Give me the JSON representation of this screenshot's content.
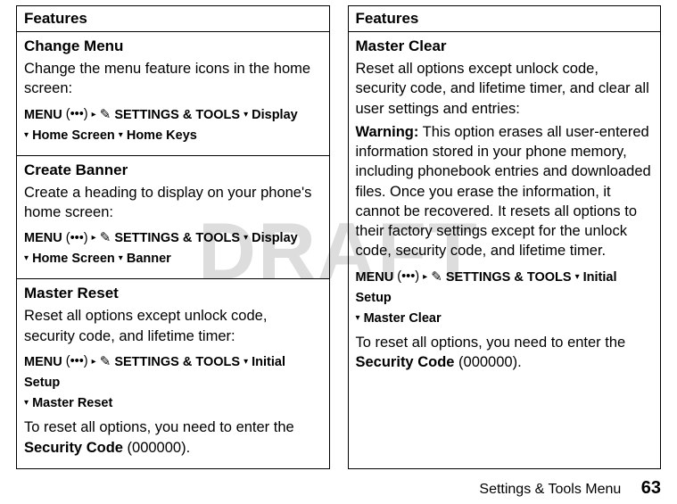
{
  "watermark": "DRAFT",
  "left": {
    "header": "Features",
    "sections": [
      {
        "title": "Change Menu",
        "body1": "Change the menu feature icons in the home screen:",
        "path_menu": "MENU",
        "path_bump": "(•••)",
        "path_arrow": "▸",
        "path_tools_icon": "✎",
        "path_tools": "SETTINGS & TOOLS",
        "path_sep": "▾",
        "path_item1": "Display",
        "path_item2": "Home Screen",
        "path_item3": "Home Keys"
      },
      {
        "title": "Create Banner",
        "body1": "Create a heading to display on your phone's home screen:",
        "path_menu": "MENU",
        "path_bump": "(•••)",
        "path_arrow": "▸",
        "path_tools_icon": "✎",
        "path_tools": "SETTINGS & TOOLS",
        "path_sep": "▾",
        "path_item1": "Display",
        "path_item2": "Home Screen",
        "path_item3": "Banner"
      },
      {
        "title": "Master Reset",
        "body1": "Reset all options except unlock code, security code, and lifetime timer:",
        "path_menu": "MENU",
        "path_bump": "(•••)",
        "path_arrow": "▸",
        "path_tools_icon": "✎",
        "path_tools": "SETTINGS & TOOLS",
        "path_sep": "▾",
        "path_item1": "Initial Setup",
        "path_item2": "Master Reset",
        "body2a": "To reset all options, you need to enter the ",
        "body2b": "Security Code",
        "body2c": " (000000)."
      }
    ]
  },
  "right": {
    "header": "Features",
    "section": {
      "title": "Master Clear",
      "body1": "Reset all options except unlock code, security code, and lifetime timer, and clear all user settings and entries:",
      "warning_label": "Warning:",
      "warning_body": " This option erases all user-entered information stored in your phone memory, including phonebook entries and downloaded files. Once you erase the information, it cannot be recovered. It resets all options to their factory settings except for the unlock code, security code, and lifetime timer.",
      "path_menu": "MENU",
      "path_bump": "(•••)",
      "path_arrow": "▸",
      "path_tools_icon": "✎",
      "path_tools": "SETTINGS & TOOLS",
      "path_sep": "▾",
      "path_item1": "Initial Setup",
      "path_item2": "Master Clear",
      "body2a": "To reset all options, you need to enter the ",
      "body2b": "Security Code",
      "body2c": " (000000)."
    }
  },
  "footer": {
    "text": "Settings & Tools Menu",
    "page": "63"
  }
}
